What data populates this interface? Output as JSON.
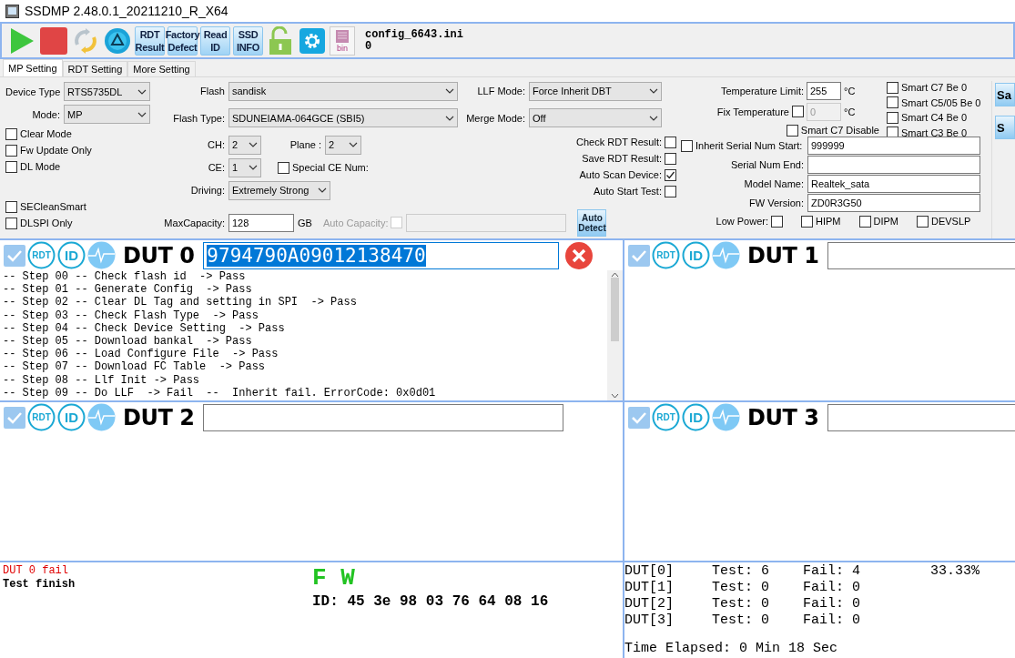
{
  "window": {
    "title": "SSDMP 2.48.0.1_20211210_R_X64"
  },
  "toolbar": {
    "buttons": [
      {
        "kind": "play"
      },
      {
        "kind": "stop"
      },
      {
        "kind": "refresh"
      },
      {
        "kind": "recycle"
      },
      {
        "kind": "text",
        "lines": [
          "RDT",
          "Result"
        ]
      },
      {
        "kind": "text",
        "lines": [
          "Factory",
          "Defect"
        ]
      },
      {
        "kind": "text",
        "lines": [
          "Read",
          "ID"
        ]
      },
      {
        "kind": "text",
        "lines": [
          "SSD",
          "INFO"
        ]
      },
      {
        "kind": "lock"
      },
      {
        "kind": "gear"
      },
      {
        "kind": "file",
        "label": "bin"
      }
    ],
    "config": {
      "file": "config_6643.ini",
      "value": "0"
    }
  },
  "tabs": [
    {
      "label": "MP Setting",
      "selected": true
    },
    {
      "label": "RDT Setting",
      "selected": false
    },
    {
      "label": "More Setting",
      "selected": false
    }
  ],
  "settings": {
    "device_type": {
      "label": "Device Type",
      "value": "RTS5735DL"
    },
    "mode": {
      "label": "Mode:",
      "value": "MP"
    },
    "left_options": [
      {
        "label": "Clear Mode",
        "checked": false
      },
      {
        "label": "Fw Update Only",
        "checked": false
      },
      {
        "label": "DL Mode",
        "checked": false
      }
    ],
    "left_options_2": [
      {
        "label": "SECleanSmart",
        "checked": false
      },
      {
        "label": "DLSPI Only",
        "checked": false
      }
    ],
    "flash": {
      "label": "Flash",
      "value": "sandisk"
    },
    "flash_type": {
      "label": "Flash Type:",
      "value": "SDUNEIAMA-064GCE (SBI5)"
    },
    "ch": {
      "label": "CH:",
      "value": "2"
    },
    "plane": {
      "label": "Plane :",
      "value": "2"
    },
    "ce": {
      "label": "CE:",
      "value": "1"
    },
    "special_ce": {
      "label": "Special CE Num:",
      "checked": false
    },
    "driving": {
      "label": "Driving:",
      "value": "Extremely Strong"
    },
    "max_capacity": {
      "label": "MaxCapacity:",
      "value": "128",
      "unit": "GB"
    },
    "auto_capacity": {
      "label": "Auto Capacity:",
      "checked": false,
      "disabled": true
    },
    "llf_mode": {
      "label": "LLF Mode:",
      "value": "Force Inherit DBT"
    },
    "merge_mode": {
      "label": "Merge Mode:",
      "value": "Off"
    },
    "rdt_options": [
      {
        "label": "Check RDT Result:",
        "checked": false
      },
      {
        "label": "Save RDT Result:",
        "checked": false
      },
      {
        "label": "Auto Scan Device:",
        "checked": true
      },
      {
        "label": "Auto Start Test:",
        "checked": false
      }
    ],
    "auto_detect": {
      "lines": [
        "Auto",
        "Detect"
      ]
    },
    "temperature_limit": {
      "label": "Temperature Limit:",
      "value": "255",
      "unit": "°C"
    },
    "fix_temperature": {
      "label": "Fix Temperature",
      "checked": false,
      "value": "0",
      "unit": "°C",
      "input_disabled": true
    },
    "smart_c7_disable": {
      "label": "Smart C7 Disable",
      "checked": false
    },
    "smart_options": [
      {
        "label": "Smart C7 Be 0",
        "checked": false
      },
      {
        "label": "Smart C5/05 Be 0",
        "checked": false
      },
      {
        "label": "Smart C4 Be 0",
        "checked": false
      },
      {
        "label": "Smart C3 Be 0",
        "checked": false
      }
    ],
    "inherit": {
      "label": "Inherit",
      "checked": false
    },
    "serial_fields": [
      {
        "label": "Serial Num Start:",
        "value": "999999"
      },
      {
        "label": "Serial Num End:"
      },
      {
        "label": "Model Name:",
        "value": "Realtek_sata"
      },
      {
        "label": "FW Version:",
        "value": "ZD0R3G50"
      }
    ],
    "low_power": {
      "label": "Low Power:",
      "checked": false
    },
    "power_options": [
      {
        "label": "HIPM",
        "checked": false
      },
      {
        "label": "DIPM",
        "checked": false
      },
      {
        "label": "DEVSLP",
        "checked": false
      }
    ],
    "side_buttons": [
      "Sa",
      "S"
    ]
  },
  "duts": [
    {
      "title": "DUT 0",
      "checked": true,
      "rdt": "RDT",
      "id": "ID",
      "serial": "9794790A09012138470",
      "serial_selected": true,
      "failed": true,
      "log": [
        "-- Step 00 -- Check flash id  -> Pass",
        "-- Step 01 -- Generate Config  -> Pass",
        "-- Step 02 -- Clear DL Tag and setting in SPI  -> Pass",
        "-- Step 03 -- Check Flash Type  -> Pass",
        "-- Step 04 -- Check Device Setting  -> Pass",
        "-- Step 05 -- Download bankal  -> Pass",
        "-- Step 06 -- Load Configure File  -> Pass",
        "-- Step 07 -- Download FC Table  -> Pass",
        "-- Step 08 -- Llf Init -> Pass",
        "-- Step 09 -- Do LLF  -> Fail  --  Inherit fail. ErrorCode: 0x0d01"
      ]
    },
    {
      "title": "DUT 1",
      "checked": true,
      "rdt": "RDT",
      "id": "ID",
      "failed": false
    },
    {
      "title": "DUT 2",
      "checked": true,
      "rdt": "RDT",
      "id": "ID",
      "failed": false
    },
    {
      "title": "DUT 3",
      "checked": true,
      "rdt": "RDT",
      "id": "ID",
      "failed": false
    }
  ],
  "messages": [
    {
      "text": "DUT 0 fail",
      "kind": "error"
    },
    {
      "text": "Test finish",
      "kind": "info"
    }
  ],
  "result": {
    "big": "F W",
    "id": "ID: 45 3e 98 03 76 64 08 16"
  },
  "stats": [
    {
      "dut": "DUT[0]",
      "test": "Test: 6",
      "fail": "Fail: 4",
      "rate": "33.33%"
    },
    {
      "dut": "DUT[1]",
      "test": "Test: 0",
      "fail": "Fail: 0"
    },
    {
      "dut": "DUT[2]",
      "test": "Test: 0",
      "fail": "Fail: 0"
    },
    {
      "dut": "DUT[3]",
      "test": "Test: 0",
      "fail": "Fail: 0"
    }
  ],
  "elapsed": "Time Elapsed: 0 Min 18 Sec"
}
